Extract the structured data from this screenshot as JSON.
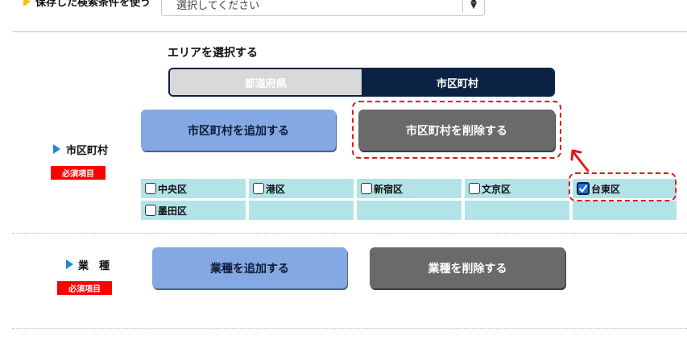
{
  "saved_search": {
    "label": "保存した検索条件を使う",
    "placeholder": "選択してください"
  },
  "area": {
    "title": "エリアを選択する",
    "tabs": [
      {
        "label": "都道府県",
        "selected": false
      },
      {
        "label": "市区町村",
        "selected": true
      }
    ]
  },
  "municipality": {
    "label": "市区町村",
    "required_badge": "必須項目",
    "add_label": "市区町村を追加する",
    "remove_label": "市区町村を削除する",
    "items": [
      {
        "label": "中央区",
        "checked": false
      },
      {
        "label": "港区",
        "checked": false
      },
      {
        "label": "新宿区",
        "checked": false
      },
      {
        "label": "文京区",
        "checked": false
      },
      {
        "label": "台東区",
        "checked": true
      },
      {
        "label": "墨田区",
        "checked": false
      }
    ]
  },
  "industry": {
    "label": "業　種",
    "required_badge": "必須項目",
    "add_label": "業種を追加する",
    "remove_label": "業種を削除する"
  },
  "colors": {
    "accent_dark": "#0c2244",
    "add_button": "#84a8e4",
    "remove_button": "#6a6a6a",
    "required_badge": "#ff0000",
    "highlight": "#e3161c",
    "checkbox_cell": "#b2e3e8"
  },
  "icons": [
    "triangle-right-icon",
    "chevron-updown-icon",
    "checkmark-icon",
    "arrow-up-right-icon"
  ]
}
